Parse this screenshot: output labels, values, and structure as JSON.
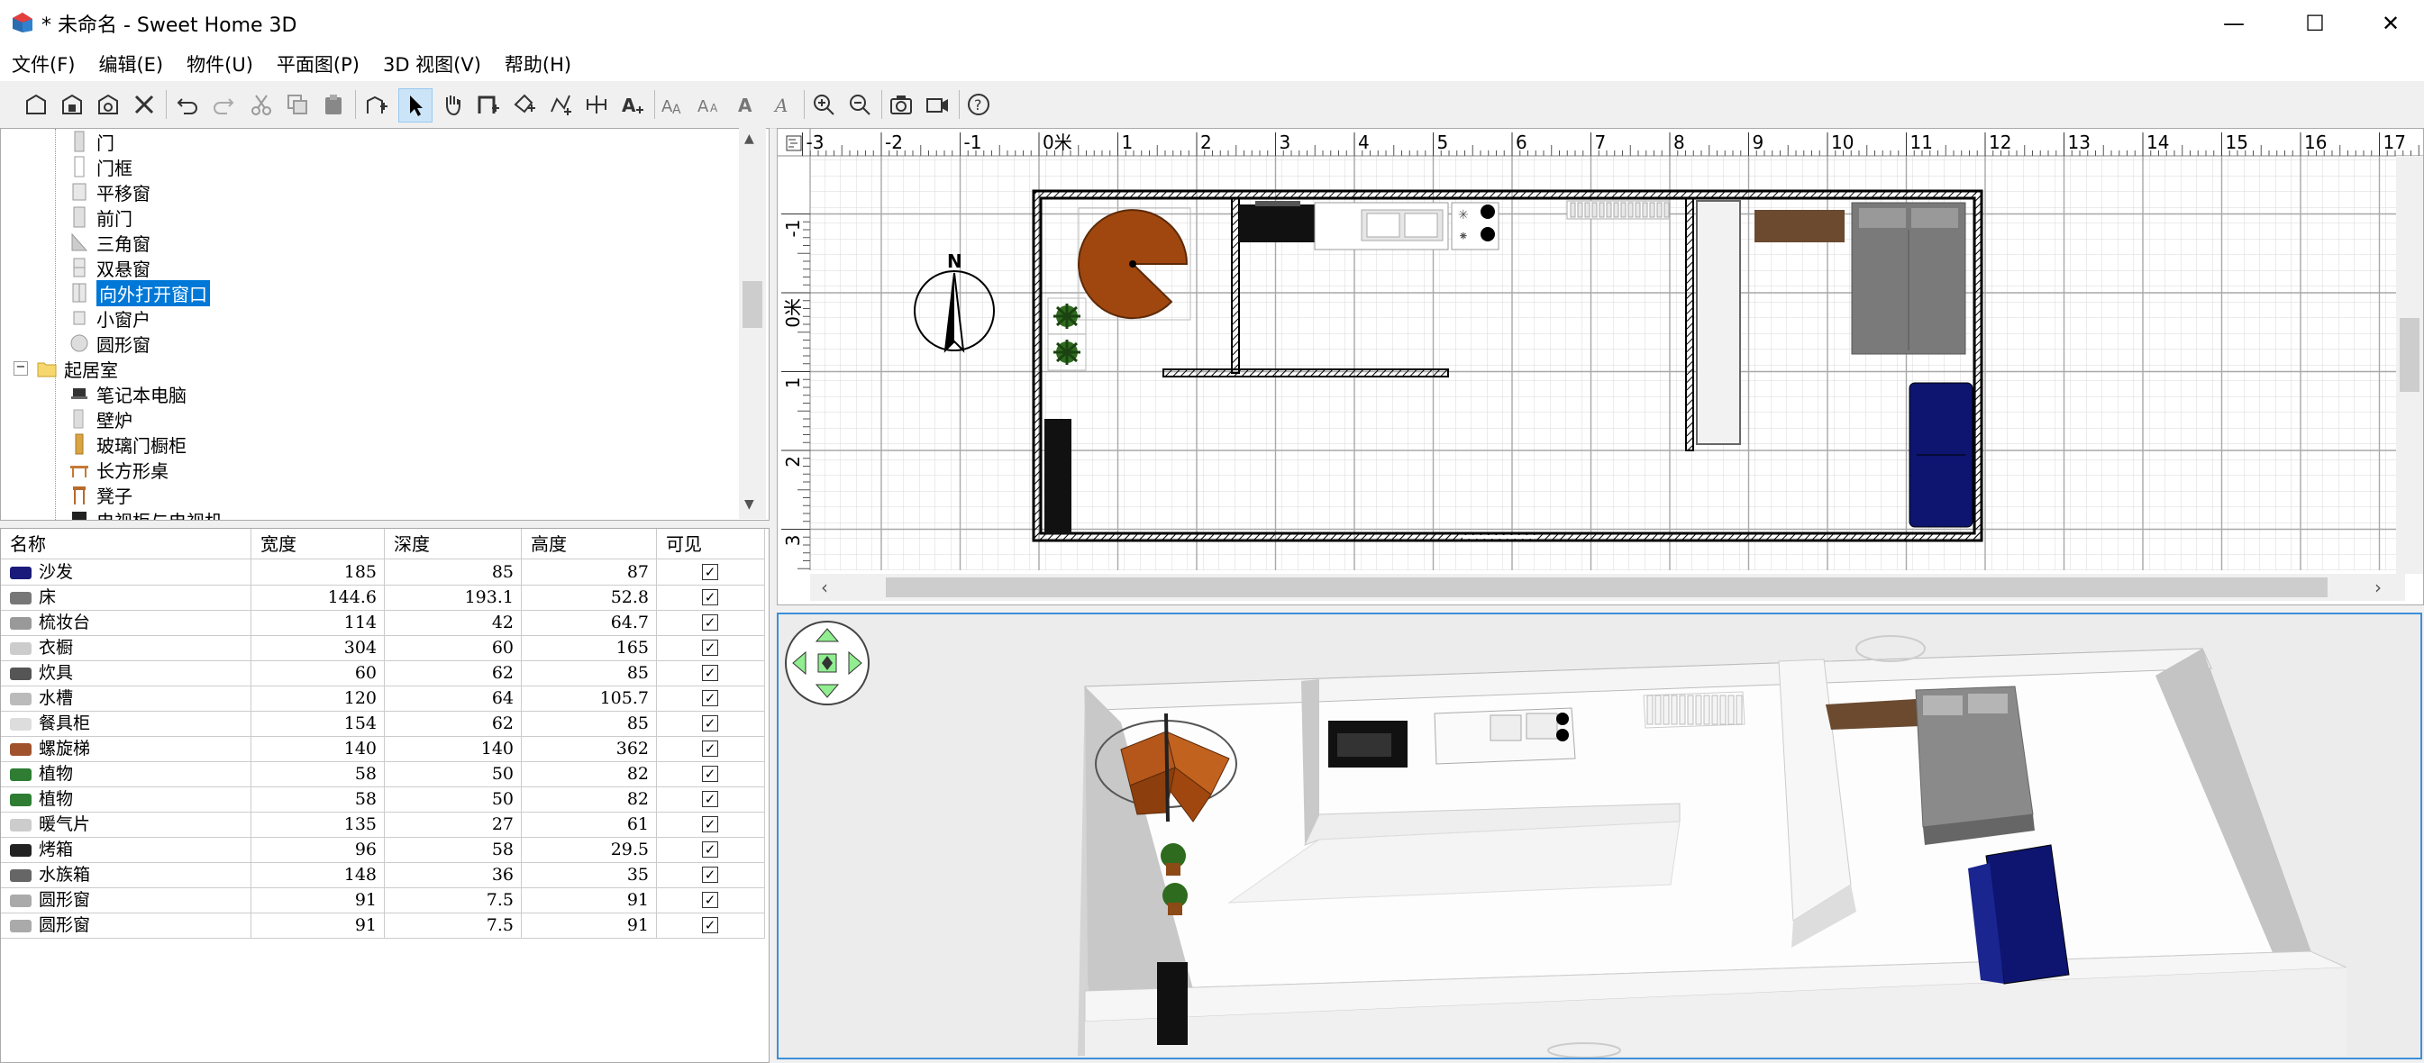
{
  "window": {
    "title": "* 未命名 - Sweet Home 3D",
    "minimize": "—",
    "maximize": "☐",
    "close": "✕"
  },
  "menu": [
    "文件(F)",
    "编辑(E)",
    "物件(U)",
    "平面图(P)",
    "3D 视图(V)",
    "帮助(H)"
  ],
  "catalog": {
    "items": [
      {
        "label": "门",
        "level": 2
      },
      {
        "label": "门框",
        "level": 2
      },
      {
        "label": "平移窗",
        "level": 2
      },
      {
        "label": "前门",
        "level": 2
      },
      {
        "label": "三角窗",
        "level": 2
      },
      {
        "label": "双悬窗",
        "level": 2
      },
      {
        "label": "向外打开窗口",
        "level": 2,
        "selected": true
      },
      {
        "label": "小窗户",
        "level": 2
      },
      {
        "label": "圆形窗",
        "level": 2
      },
      {
        "label": "起居室",
        "level": 1,
        "folder": true
      },
      {
        "label": "笔记本电脑",
        "level": 2
      },
      {
        "label": "壁炉",
        "level": 2
      },
      {
        "label": "玻璃门橱柜",
        "level": 2
      },
      {
        "label": "长方形桌",
        "level": 2
      },
      {
        "label": "凳子",
        "level": 2
      },
      {
        "label": "电视柜与电视机",
        "level": 2
      }
    ]
  },
  "furniture": {
    "headers": [
      "名称",
      "宽度",
      "深度",
      "高度",
      "可见"
    ],
    "rows": [
      {
        "name": "沙发",
        "w": "185",
        "d": "85",
        "h": "87",
        "visible": true,
        "icon": "#1a1a7a"
      },
      {
        "name": "床",
        "w": "144.6",
        "d": "193.1",
        "h": "52.8",
        "visible": true,
        "icon": "#777777"
      },
      {
        "name": "梳妆台",
        "w": "114",
        "d": "42",
        "h": "64.7",
        "visible": true,
        "icon": "#999999"
      },
      {
        "name": "衣橱",
        "w": "304",
        "d": "60",
        "h": "165",
        "visible": true,
        "icon": "#cccccc"
      },
      {
        "name": "炊具",
        "w": "60",
        "d": "62",
        "h": "85",
        "visible": true,
        "icon": "#555555"
      },
      {
        "name": "水槽",
        "w": "120",
        "d": "64",
        "h": "105.7",
        "visible": true,
        "icon": "#bbbbbb"
      },
      {
        "name": "餐具柜",
        "w": "154",
        "d": "62",
        "h": "85",
        "visible": true,
        "icon": "#dddddd"
      },
      {
        "name": "螺旋梯",
        "w": "140",
        "d": "140",
        "h": "362",
        "visible": true,
        "icon": "#a0522d"
      },
      {
        "name": "植物",
        "w": "58",
        "d": "50",
        "h": "82",
        "visible": true,
        "icon": "#2e7d32"
      },
      {
        "name": "植物",
        "w": "58",
        "d": "50",
        "h": "82",
        "visible": true,
        "icon": "#2e7d32"
      },
      {
        "name": "暖气片",
        "w": "135",
        "d": "27",
        "h": "61",
        "visible": true,
        "icon": "#cccccc"
      },
      {
        "name": "烤箱",
        "w": "96",
        "d": "58",
        "h": "29.5",
        "visible": true,
        "icon": "#222222"
      },
      {
        "name": "水族箱",
        "w": "148",
        "d": "36",
        "h": "35",
        "visible": true,
        "icon": "#666666"
      },
      {
        "name": "圆形窗",
        "w": "91",
        "d": "7.5",
        "h": "91",
        "visible": true,
        "icon": "#aaaaaa"
      },
      {
        "name": "圆形窗",
        "w": "91",
        "d": "7.5",
        "h": "91",
        "visible": true,
        "icon": "#aaaaaa"
      }
    ]
  },
  "plan": {
    "ruler_top": [
      "-3",
      "-2",
      "-1",
      "0米",
      "1",
      "2",
      "3",
      "4",
      "5",
      "6",
      "7",
      "8",
      "9",
      "10",
      "11",
      "12",
      "13",
      "14",
      "15",
      "16",
      "17"
    ],
    "ruler_left": [
      "-1",
      "0米",
      "1",
      "2",
      "3"
    ],
    "compass_label": "N",
    "scroll_left": "‹",
    "scroll_right": "›"
  },
  "colors": {
    "accent": "#0078d7",
    "stair": "#a0470f",
    "sofa": "#0d1570",
    "bed": "#7a7a7a",
    "dresser": "#6b4a2f",
    "plant": "#2e6b1e",
    "nav": "#90ee90"
  }
}
